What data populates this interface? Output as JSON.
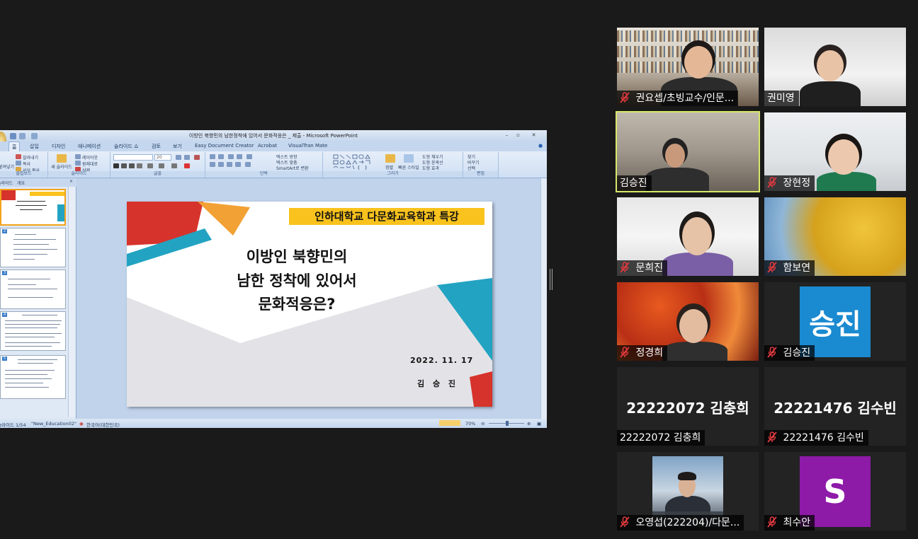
{
  "powerpoint": {
    "window_title": "이방인 북향민의 남한정착에 있어서 문화적응은 _ 제출 - Microsoft PowerPoint",
    "tabs": [
      "홈",
      "삽입",
      "디자인",
      "애니메이션",
      "슬라이드 쇼",
      "검토",
      "보기",
      "Easy Document Creator",
      "Acrobat",
      "VisualTran Mate"
    ],
    "ribbon": {
      "clipboard": {
        "cut": "잘라내기",
        "copy": "복사",
        "format_painter": "서식 복사",
        "paste": "붙여넣기",
        "label": "클립보드"
      },
      "slides": {
        "new_slide": "새 슬라이드",
        "layout": "레이아웃",
        "reset": "원래대로",
        "delete": "삭제",
        "label": "슬라이드"
      },
      "font": {
        "size": "20",
        "label": "글꼴"
      },
      "paragraph": {
        "text_direction": "텍스트 방향",
        "align_text": "텍스트 맞춤",
        "smartart": "SmartArt로 변환",
        "label": "단락"
      },
      "drawing": {
        "arrange": "정렬",
        "quick_styles": "빠른 스타일",
        "fill": "도형 채우기",
        "outline": "도형 윤곽선",
        "effects": "도형 효과",
        "label": "그리기"
      },
      "editing": {
        "find": "찾기",
        "replace": "바꾸기",
        "select": "선택",
        "label": "편집"
      }
    },
    "left_tabs": [
      "슬라이드",
      "개요"
    ],
    "slide": {
      "banner": "인하대학교 다문화교육학과 특강",
      "title_line1": "이방인 북향민의",
      "title_line2": "남한 정착에 있어서",
      "title_line3": "문화적응은?",
      "date": "2022. 11. 17",
      "author": "김 승 진"
    },
    "status": {
      "slide_count": "슬라이드 1/54",
      "theme": "\"New_Education02\"",
      "language": "한국어(대한민국)",
      "zoom": "70%"
    }
  },
  "participants": [
    {
      "name": "권요셉/초빙교수/인문...",
      "muted": true,
      "speaker": false
    },
    {
      "name": "권미영",
      "muted": false,
      "speaker": false
    },
    {
      "name": "김승진",
      "muted": false,
      "speaker": true
    },
    {
      "name": "장현정",
      "muted": true,
      "speaker": false
    },
    {
      "name": "문희진",
      "muted": true,
      "speaker": false
    },
    {
      "name": "함보연",
      "muted": true,
      "speaker": false
    },
    {
      "name": "정경희",
      "muted": true,
      "speaker": false
    },
    {
      "name": "김승진",
      "muted": true,
      "speaker": false,
      "avatar_text": "승진",
      "avatar_color": "#1a8ad1"
    },
    {
      "name": "22222072 김충희",
      "muted": false,
      "speaker": false,
      "big_name": "22222072 김충희"
    },
    {
      "name": "22221476 김수빈",
      "muted": true,
      "speaker": false,
      "big_name": "22221476 김수빈"
    },
    {
      "name": "오영섭(222204)/다문...",
      "muted": true,
      "speaker": false
    },
    {
      "name": "최수안",
      "muted": true,
      "speaker": false,
      "avatar_text": "S",
      "avatar_color": "#8e1aa8"
    }
  ],
  "colors": {
    "speaker_border": "#d7e86a",
    "mute_icon": "#e0393e",
    "background": "#1a1a1a"
  }
}
